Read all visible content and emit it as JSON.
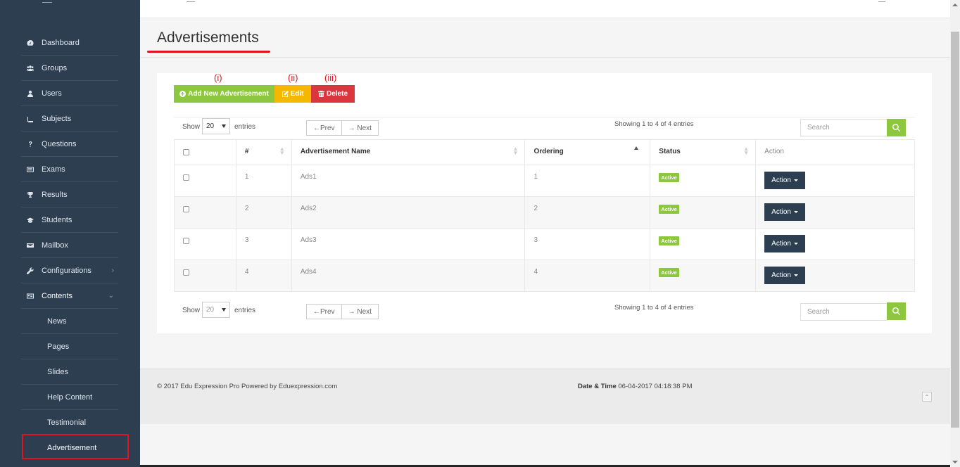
{
  "sidebar": {
    "items": [
      {
        "label": "Dashboard",
        "icon": "dashboard-icon"
      },
      {
        "label": "Groups",
        "icon": "groups-icon"
      },
      {
        "label": "Users",
        "icon": "user-icon"
      },
      {
        "label": "Subjects",
        "icon": "book-icon"
      },
      {
        "label": "Questions",
        "icon": "question-icon"
      },
      {
        "label": "Exams",
        "icon": "list-icon"
      },
      {
        "label": "Results",
        "icon": "trophy-icon"
      },
      {
        "label": "Students",
        "icon": "graduation-cap-icon"
      },
      {
        "label": "Mailbox",
        "icon": "envelope-icon"
      },
      {
        "label": "Configurations",
        "icon": "wrench-icon"
      },
      {
        "label": "Contents",
        "icon": "card-icon"
      }
    ],
    "sub_items": [
      "News",
      "Pages",
      "Slides",
      "Help Content",
      "Testimonial",
      "Advertisement"
    ]
  },
  "page": {
    "title": "Advertisements"
  },
  "toolbar": {
    "markers": [
      "(i)",
      "(ii)",
      "(iii)"
    ],
    "add_label": "Add New Advertisement",
    "edit_label": "Edit",
    "delete_label": "Delete"
  },
  "controls": {
    "show_label": "Show",
    "page_size": "20",
    "entries_label": "entries",
    "prev_label": "←Prev",
    "next_label": "→ Next",
    "showing_text": "Showing 1 to 4 of 4 entries",
    "search_placeholder": "Search"
  },
  "table": {
    "headers": [
      "#",
      "Advertisement Name",
      "Ordering",
      "Status",
      "Action"
    ],
    "rows": [
      {
        "num": "1",
        "name": "Ads1",
        "ordering": "1",
        "status": "Active",
        "action": "Action"
      },
      {
        "num": "2",
        "name": "Ads2",
        "ordering": "2",
        "status": "Active",
        "action": "Action"
      },
      {
        "num": "3",
        "name": "Ads3",
        "ordering": "3",
        "status": "Active",
        "action": "Action"
      },
      {
        "num": "4",
        "name": "Ads4",
        "ordering": "4",
        "status": "Active",
        "action": "Action"
      }
    ]
  },
  "footer": {
    "copyright": "© 2017 Edu Expression Pro Powered by Eduexpression.com",
    "datetime_label": "Date & Time",
    "datetime_value": "06-04-2017 04:18:38 PM"
  },
  "colors": {
    "sidebar_bg": "#2c3e50",
    "add_green": "#8dc63f",
    "edit_yellow": "#f5b800",
    "delete_red": "#d9363e",
    "highlight_red": "#e0141e"
  }
}
